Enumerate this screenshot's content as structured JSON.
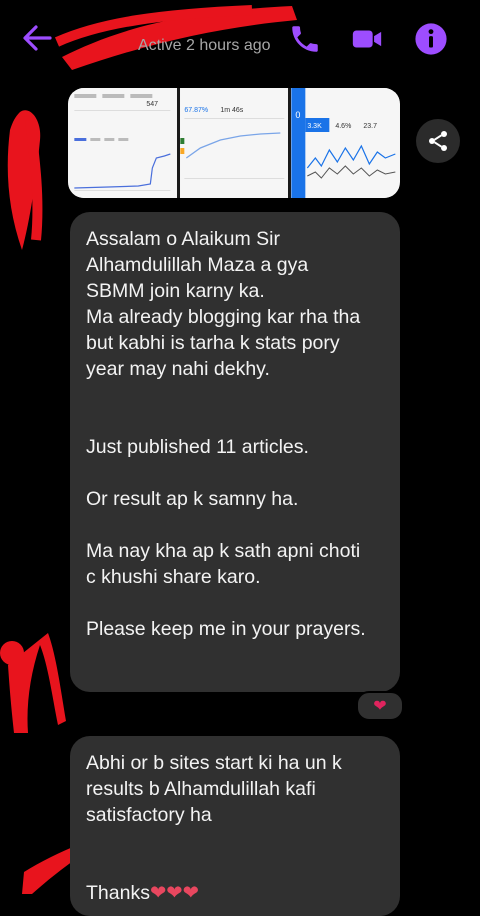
{
  "header": {
    "status": "Active 2 hours ago",
    "icons": [
      "back-arrow-icon",
      "phone-icon",
      "video-camera-icon",
      "info-icon"
    ],
    "accent_color": "#9d4dff"
  },
  "attachments": {
    "thumb_texts": {
      "t1_metric": "547",
      "t2_metric_a": "67.87%",
      "t2_metric_b": "1m 46s",
      "t3_metric_a": "0",
      "t3_metric_b": "3.3K",
      "t3_metric_c": "4.6%",
      "t3_metric_d": "23.7"
    },
    "share_icon": "share-icon"
  },
  "messages": [
    {
      "lines": [
        "Assalam o Alaikum Sir",
        "",
        "Alhamdulillah Maza a gya",
        "SBMM join karny ka.",
        "",
        "Ma already blogging kar rha tha",
        "but kabhi is tarha k stats pory",
        "year may nahi dekhy.",
        "",
        "",
        "Just published 11 articles.",
        "",
        "Or result ap k samny ha.",
        "",
        "Ma nay kha ap k sath apni choti",
        "c khushi share karo.",
        "",
        "Please keep me in your prayers."
      ],
      "reaction": "❤"
    },
    {
      "lines": [
        "Abhi or b sites start ki ha un k",
        "results b Alhamdulillah kafi",
        "satisfactory ha",
        "",
        "",
        "Thanks"
      ],
      "trailing": "❤❤❤"
    }
  ]
}
